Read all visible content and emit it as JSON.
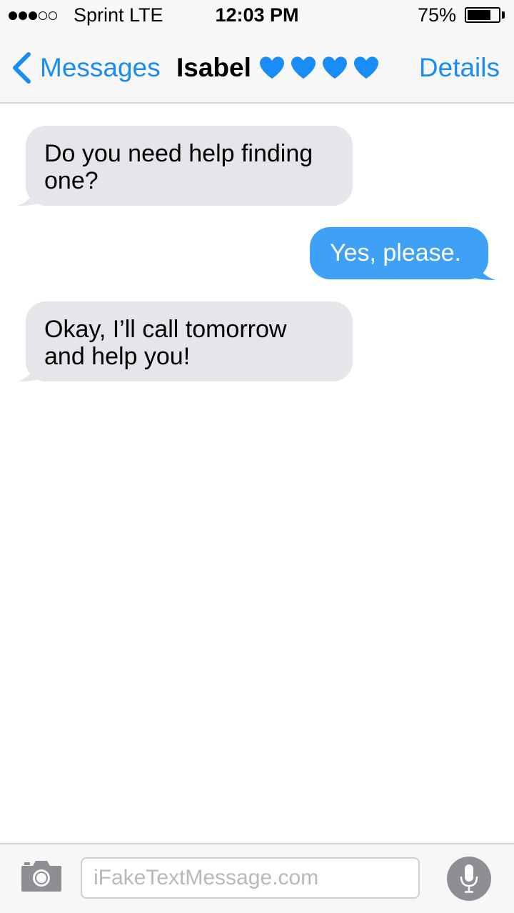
{
  "status_bar": {
    "signal_bars_filled": 3,
    "signal_bars_total": 5,
    "carrier": "Sprint  LTE",
    "time": "12:03 PM",
    "battery_percent": "75%",
    "battery_level": 0.75
  },
  "nav": {
    "back_label": "Messages",
    "contact_name": "Isabel",
    "contact_emoji": [
      "blue-heart",
      "blue-heart",
      "blue-heart",
      "blue-heart"
    ],
    "details_label": "Details"
  },
  "messages": [
    {
      "direction": "received",
      "line1": "Do you need help finding",
      "line2": "one?"
    },
    {
      "direction": "sent",
      "line1": "Yes, please."
    },
    {
      "direction": "received",
      "line1": "Okay, I’ll call tomorrow",
      "line2": "and help you!"
    }
  ],
  "input_bar": {
    "placeholder": "iFakeTextMessage.com",
    "camera_icon": "camera-icon",
    "mic_icon": "microphone-icon"
  },
  "colors": {
    "accent": "#1a8cf5",
    "sent_bubble": "#3ea1f5",
    "received_bubble": "#e5e5ea",
    "heart": "#1a8cf5"
  }
}
